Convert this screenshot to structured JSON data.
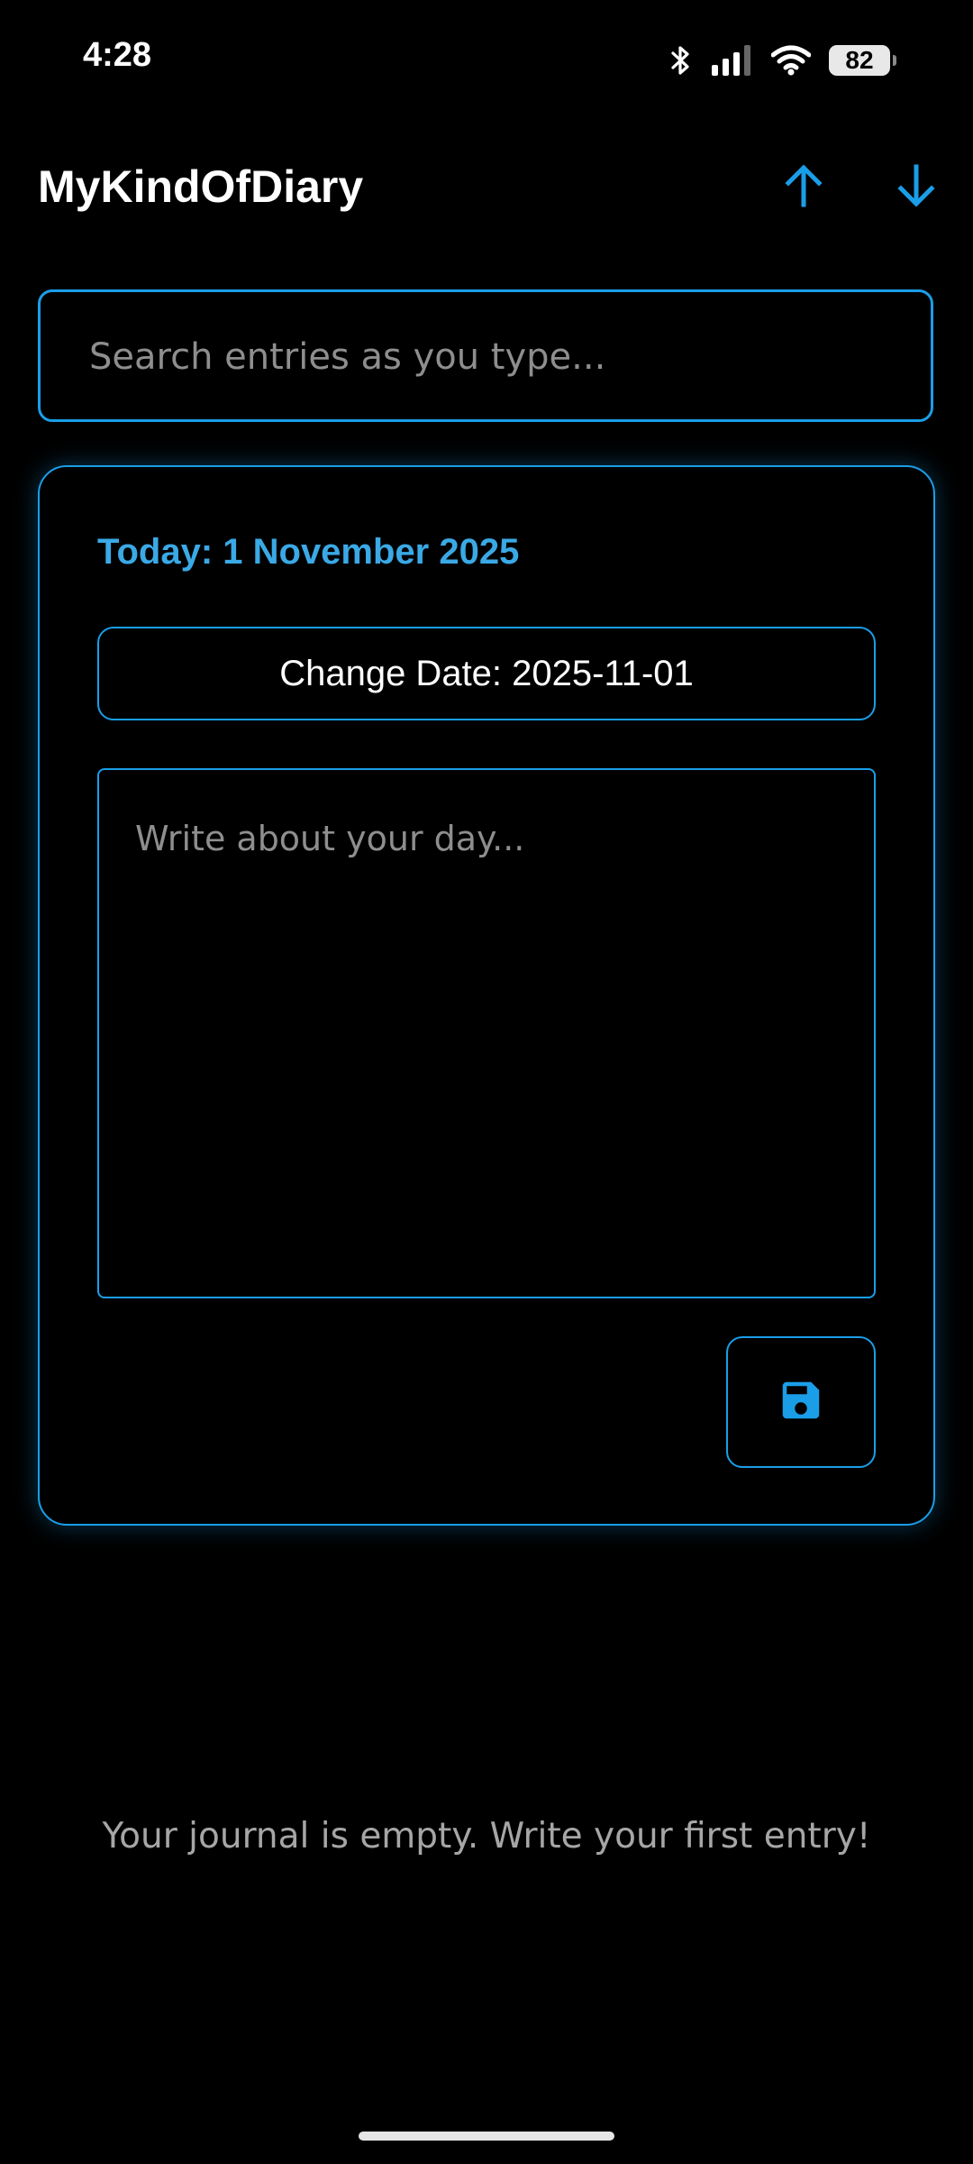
{
  "status_bar": {
    "time": "4:28",
    "battery_level": "82",
    "icons": [
      "bluetooth-icon",
      "signal-icon",
      "wifi-icon",
      "battery-icon"
    ]
  },
  "app_bar": {
    "title": "MyKindOfDiary",
    "actions": [
      "arrow-up-icon",
      "arrow-down-icon"
    ]
  },
  "search": {
    "placeholder": "Search entries as you type...",
    "value": ""
  },
  "entry_card": {
    "today_label": "Today: 1 November 2025",
    "change_date_label": "Change Date: 2025-11-01",
    "entry_placeholder": "Write about your day...",
    "entry_value": "",
    "save_icon": "save-icon"
  },
  "empty_state": {
    "message": "Your journal is empty. Write your first entry!"
  },
  "colors": {
    "background": "#000000",
    "accent": "#1a9ee8",
    "accent_text": "#3aa9e6",
    "muted_text": "#a6a6a6"
  }
}
